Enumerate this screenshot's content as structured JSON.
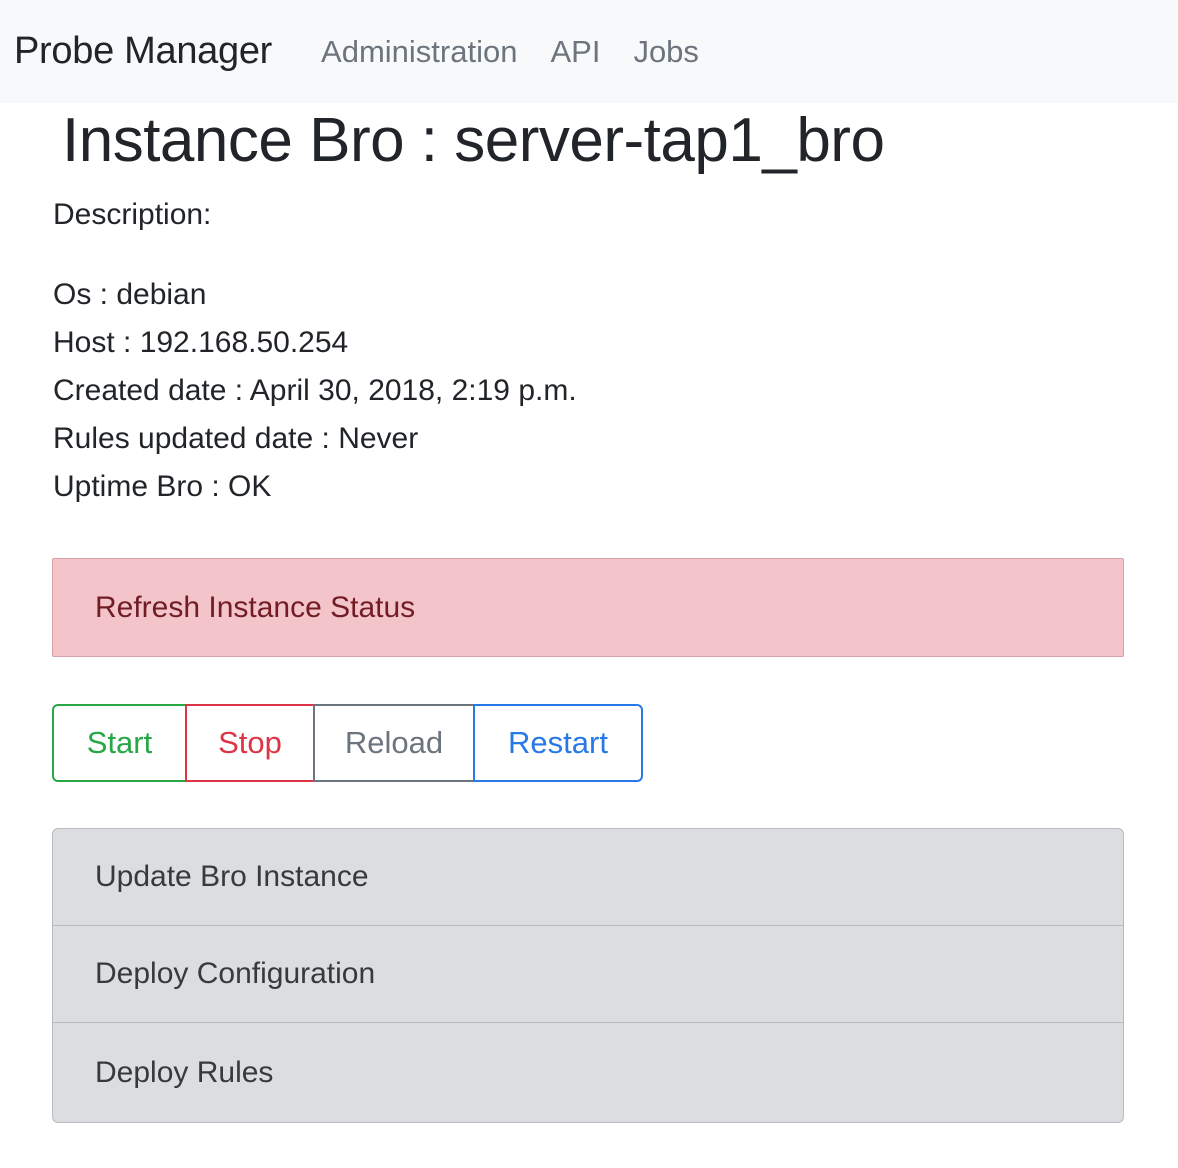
{
  "navbar": {
    "brand": "Probe Manager",
    "links": [
      "Administration",
      "API",
      "Jobs"
    ]
  },
  "page": {
    "title": "Instance Bro : server-tap1_bro",
    "description_label": "Description:",
    "details": [
      "Os : debian",
      "Host : 192.168.50.254",
      "Created date : April 30, 2018, 2:19 p.m.",
      "Rules updated date : Never",
      "Uptime Bro : OK"
    ]
  },
  "status": {
    "refresh_label": "Refresh Instance Status",
    "color": "#f4c4cb"
  },
  "controls": {
    "start": "Start",
    "stop": "Stop",
    "reload": "Reload",
    "restart": "Restart"
  },
  "actions": [
    "Update Bro Instance",
    "Deploy Configuration",
    "Deploy Rules"
  ],
  "colors": {
    "success": "#28a745",
    "danger": "#dc3545",
    "secondary": "#6c757d",
    "primary": "#2779e8"
  }
}
